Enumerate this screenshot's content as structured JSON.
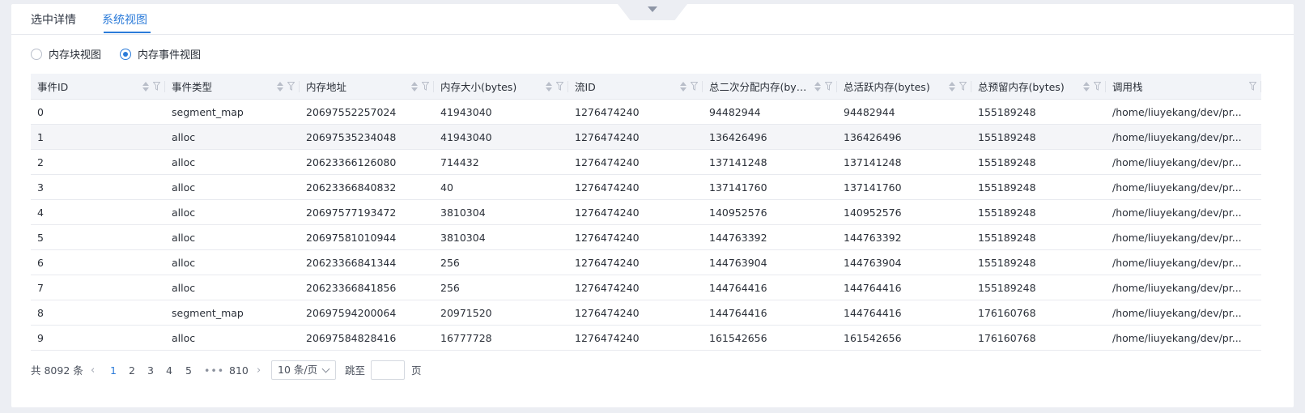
{
  "tabs": [
    {
      "label": "选中详情"
    },
    {
      "label": "系统视图"
    }
  ],
  "view_toggle": {
    "options": [
      "内存块视图",
      "内存事件视图"
    ],
    "selected": "内存事件视图"
  },
  "table": {
    "columns": [
      "事件ID",
      "事件类型",
      "内存地址",
      "内存大小(bytes)",
      "流ID",
      "总二次分配内存(byte...",
      "总活跃内存(bytes)",
      "总预留内存(bytes)",
      "调用栈"
    ],
    "rows": [
      [
        "0",
        "segment_map",
        "20697552257024",
        "41943040",
        "1276474240",
        "94482944",
        "94482944",
        "155189248",
        "/home/liuyekang/dev/pr..."
      ],
      [
        "1",
        "alloc",
        "20697535234048",
        "41943040",
        "1276474240",
        "136426496",
        "136426496",
        "155189248",
        "/home/liuyekang/dev/pr..."
      ],
      [
        "2",
        "alloc",
        "20623366126080",
        "714432",
        "1276474240",
        "137141248",
        "137141248",
        "155189248",
        "/home/liuyekang/dev/pr..."
      ],
      [
        "3",
        "alloc",
        "20623366840832",
        "40",
        "1276474240",
        "137141760",
        "137141760",
        "155189248",
        "/home/liuyekang/dev/pr..."
      ],
      [
        "4",
        "alloc",
        "20697577193472",
        "3810304",
        "1276474240",
        "140952576",
        "140952576",
        "155189248",
        "/home/liuyekang/dev/pr..."
      ],
      [
        "5",
        "alloc",
        "20697581010944",
        "3810304",
        "1276474240",
        "144763392",
        "144763392",
        "155189248",
        "/home/liuyekang/dev/pr..."
      ],
      [
        "6",
        "alloc",
        "20623366841344",
        "256",
        "1276474240",
        "144763904",
        "144763904",
        "155189248",
        "/home/liuyekang/dev/pr..."
      ],
      [
        "7",
        "alloc",
        "20623366841856",
        "256",
        "1276474240",
        "144764416",
        "144764416",
        "155189248",
        "/home/liuyekang/dev/pr..."
      ],
      [
        "8",
        "segment_map",
        "20697594200064",
        "20971520",
        "1276474240",
        "144764416",
        "144764416",
        "176160768",
        "/home/liuyekang/dev/pr..."
      ],
      [
        "9",
        "alloc",
        "20697584828416",
        "16777728",
        "1276474240",
        "161542656",
        "161542656",
        "176160768",
        "/home/liuyekang/dev/pr..."
      ]
    ],
    "selected_row": 1
  },
  "pagination": {
    "total_text": "共 8092 条",
    "pages": [
      "1",
      "2",
      "3",
      "4",
      "5"
    ],
    "ellipsis": "•••",
    "last_page": "810",
    "current_page": "1",
    "page_size": "10 条/页",
    "jump_label": "跳至",
    "jump_suffix": "页",
    "jump_value": ""
  },
  "colors": {
    "accent": "#2b7bd9",
    "header_bg": "#f2f4f8",
    "page_bg": "#eceef3"
  }
}
